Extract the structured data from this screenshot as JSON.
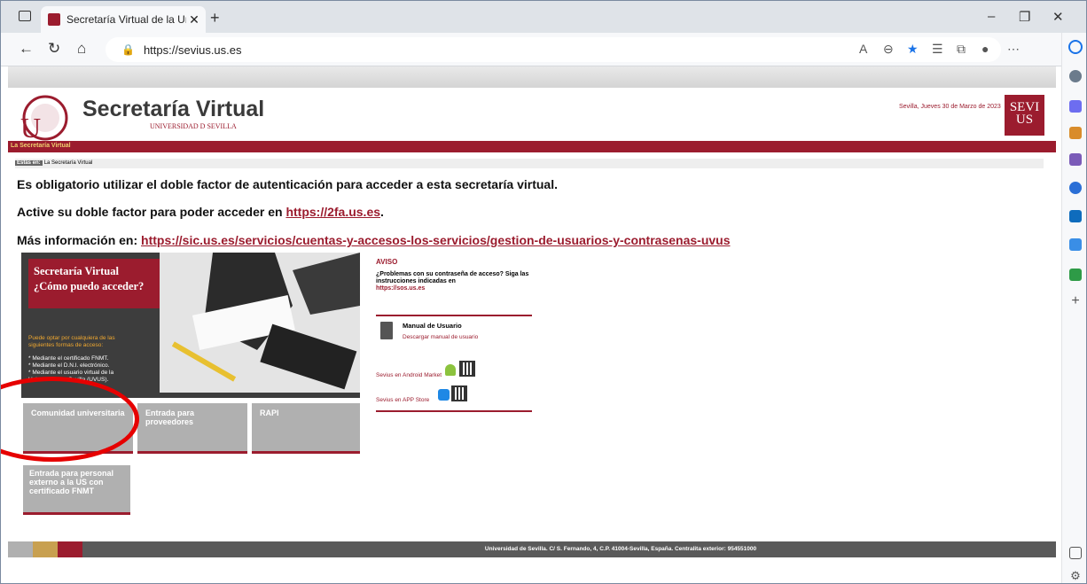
{
  "browser": {
    "tab_title": "Secretaría Virtual de la Universid",
    "url": "https://sevius.us.es"
  },
  "header": {
    "title": "Secretaría Virtual",
    "subtitle": "UNIVERSIDAD D SEVILLA",
    "date": "Sevilla, Jueves 30 de Marzo de 2023",
    "logo_text": "SEVI US"
  },
  "nav_bar_label": "La Secretaría Virtual",
  "breadcrumb": {
    "label": "Estás en:",
    "value": "La Secretaría Virtual"
  },
  "messages": {
    "line1": "Es obligatorio utilizar el doble factor de autenticación para acceder a esta secretaría virtual.",
    "line2_prefix": "Active su doble factor para poder acceder en ",
    "line2_link": "https://2fa.us.es",
    "line2_suffix": ".",
    "line3_prefix": "Más información en: ",
    "line3_link": "https://sic.us.es/servicios/cuentas-y-accesos-los-servicios/gestion-de-usuarios-y-contrasenas-uvus"
  },
  "promo": {
    "heading_line1": "Secretaría Virtual",
    "heading_line2": "¿Cómo puedo acceder?",
    "intro": "Puede optar por cualquiera de las siguientes formas de acceso:",
    "options": [
      "* Mediante el certificado FNMT.",
      "* Mediante el D.N.I. electrónico.",
      "* Mediante el usuario virtual de la Universidad de Sevilla (UVUS)."
    ]
  },
  "tiles": {
    "comunidad": "Comunidad universitaria",
    "proveedores": "Entrada para proveedores",
    "rapi": "RAPI",
    "externo": "Entrada para personal externo a la US con certificado FNMT"
  },
  "aviso": {
    "heading": "AVISO",
    "text": "¿Problemas con su contraseña de acceso? Siga las instrucciones indicadas en",
    "link": "https://sos.us.es"
  },
  "manual": {
    "title": "Manual de Usuario",
    "link": "Descargar manual de usuario"
  },
  "stores": {
    "android": "Sevius en Android Market",
    "apple": "Sevius en APP Store"
  },
  "footer": "Universidad de Sevilla. C/ S. Fernando, 4, C.P. 41004-Sevilla, España. Centralita exterior: 954551000",
  "colors": {
    "brand": "#9b1c2e",
    "annotation": "#e60000"
  }
}
